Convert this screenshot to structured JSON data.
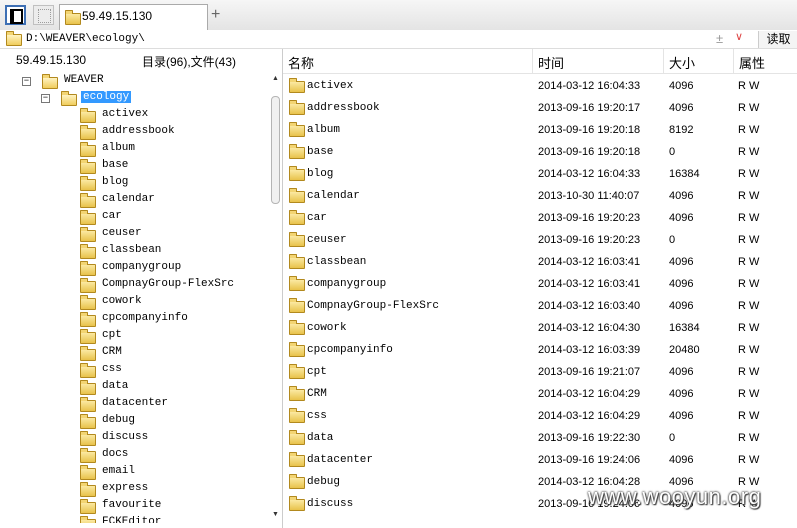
{
  "tabs": [
    {
      "label": "59.49.15.130",
      "icon": "folder-icon",
      "active": true
    }
  ],
  "tab_add_label": "+",
  "address": {
    "value": "D:\\WEAVER\\ecology\\",
    "pin_glyph": "±",
    "dropdown_glyph": "∨",
    "read_button": "读取"
  },
  "left_panel": {
    "host": "59.49.15.130",
    "summary": "目录(96),文件(43)",
    "tree": {
      "root": {
        "label": "WEAVER",
        "expander": "−"
      },
      "current": {
        "label": "ecology",
        "expander": "−"
      },
      "children": [
        "activex",
        "addressbook",
        "album",
        "base",
        "blog",
        "calendar",
        "car",
        "ceuser",
        "classbean",
        "companygroup",
        "CompnayGroup-FlexSrc",
        "cowork",
        "cpcompanyinfo",
        "cpt",
        "CRM",
        "css",
        "data",
        "datacenter",
        "debug",
        "discuss",
        "docs",
        "email",
        "express",
        "favourite",
        "FCKEditor"
      ]
    },
    "scroll_up": "▲",
    "scroll_down": "▼"
  },
  "file_list": {
    "columns": {
      "name": "名称",
      "time": "时间",
      "size": "大小",
      "attr": "属性"
    },
    "rows": [
      {
        "name": "activex",
        "time": "2014-03-12 16:04:33",
        "size": "4096",
        "attr": "R W"
      },
      {
        "name": "addressbook",
        "time": "2013-09-16 19:20:17",
        "size": "4096",
        "attr": "R W"
      },
      {
        "name": "album",
        "time": "2013-09-16 19:20:18",
        "size": "8192",
        "attr": "R W"
      },
      {
        "name": "base",
        "time": "2013-09-16 19:20:18",
        "size": "0",
        "attr": "R W"
      },
      {
        "name": "blog",
        "time": "2014-03-12 16:04:33",
        "size": "16384",
        "attr": "R W"
      },
      {
        "name": "calendar",
        "time": "2013-10-30 11:40:07",
        "size": "4096",
        "attr": "R W"
      },
      {
        "name": "car",
        "time": "2013-09-16 19:20:23",
        "size": "4096",
        "attr": "R W"
      },
      {
        "name": "ceuser",
        "time": "2013-09-16 19:20:23",
        "size": "0",
        "attr": "R W"
      },
      {
        "name": "classbean",
        "time": "2014-03-12 16:03:41",
        "size": "4096",
        "attr": "R W"
      },
      {
        "name": "companygroup",
        "time": "2014-03-12 16:03:41",
        "size": "4096",
        "attr": "R W"
      },
      {
        "name": "CompnayGroup-FlexSrc",
        "time": "2014-03-12 16:03:40",
        "size": "4096",
        "attr": "R W"
      },
      {
        "name": "cowork",
        "time": "2014-03-12 16:04:30",
        "size": "16384",
        "attr": "R W"
      },
      {
        "name": "cpcompanyinfo",
        "time": "2014-03-12 16:03:39",
        "size": "20480",
        "attr": "R W"
      },
      {
        "name": "cpt",
        "time": "2013-09-16 19:21:07",
        "size": "4096",
        "attr": "R W"
      },
      {
        "name": "CRM",
        "time": "2014-03-12 16:04:29",
        "size": "4096",
        "attr": "R W"
      },
      {
        "name": "css",
        "time": "2014-03-12 16:04:29",
        "size": "4096",
        "attr": "R W"
      },
      {
        "name": "data",
        "time": "2013-09-16 19:22:30",
        "size": "0",
        "attr": "R W"
      },
      {
        "name": "datacenter",
        "time": "2013-09-16 19:24:06",
        "size": "4096",
        "attr": "R W"
      },
      {
        "name": "debug",
        "time": "2014-03-12 16:04:28",
        "size": "4096",
        "attr": "R W"
      },
      {
        "name": "discuss",
        "time": "2013-09-16 19:24:06",
        "size": "4096",
        "attr": "R W"
      }
    ]
  },
  "watermark": "www.wooyun.org",
  "colors": {
    "selection": "#3399ff",
    "folder": "#f0cd5d",
    "accent": "#3d6fb4"
  }
}
